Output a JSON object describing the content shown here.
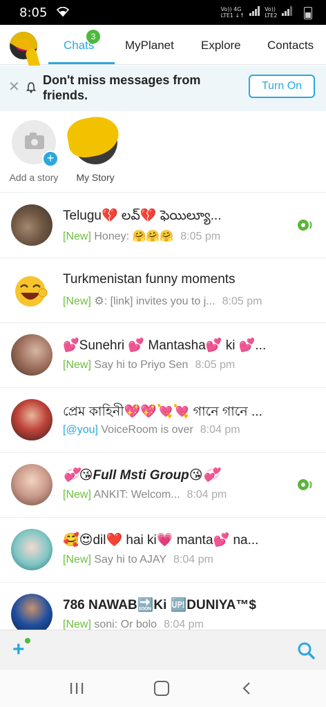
{
  "status_bar": {
    "time": "8:05",
    "network_left": "Vo)) 4G\nLTE1 ↓↑",
    "network_right": "Vo))\nLTE2"
  },
  "tabs": {
    "items": [
      {
        "label": "Chats",
        "active": true,
        "badge": "3"
      },
      {
        "label": "MyPlanet"
      },
      {
        "label": "Explore"
      },
      {
        "label": "Contacts"
      }
    ],
    "accent_color": "#29a8e0",
    "badge_color": "#4cba3c"
  },
  "notice": {
    "message": "Don't miss messages from friends.",
    "close_icon": "close-icon",
    "bell_icon": "bell-icon",
    "button_label": "Turn On"
  },
  "stories": [
    {
      "label": "Add a story",
      "icon": "camera-icon"
    },
    {
      "label": "My Story"
    }
  ],
  "chats": [
    {
      "name": "Telugu💔 లవ్💔 ఫెయిల్యూ...",
      "tag": "[New]",
      "preview": "Honey: 🤗🤗🤗",
      "time": "8:05 pm",
      "voice": true
    },
    {
      "name": "Turkmenistan funny moments",
      "tag": "[New]",
      "preview": "⚙: [link] invites you to j...",
      "time": "8:05 pm",
      "voice": false
    },
    {
      "name": "💕Sunehri 💕 Mantasha💕 ki 💕...",
      "tag": "[New]",
      "preview": "Say hi to Priyo Sen",
      "time": "8:05 pm",
      "voice": false
    },
    {
      "name": "প্রেম কাহিনী💖💖💘💘 গানে গানে ...",
      "tag": "[@you]",
      "preview": "VoiceRoom is over",
      "time": "8:04 pm",
      "voice": false
    },
    {
      "name": "💞😘Full Msti Group😘💞",
      "tag": "[New]",
      "preview": "ANKIT: Welcom...",
      "time": "8:04 pm",
      "voice": true
    },
    {
      "name": "🥰😍dil❤️ hai ki💗 manta💕 na...",
      "tag": "[New]",
      "preview": "Say hi to AJAY",
      "time": "8:04 pm",
      "voice": false
    },
    {
      "name": "786 NAWAB🔜Ki 🆙DUNIYA™$",
      "tag": "[New]",
      "preview": "soni: Or bolo",
      "time": "8:04 pm",
      "voice": false
    }
  ],
  "toolbar": {
    "add_icon": "plus-icon",
    "search_icon": "search-icon"
  },
  "navbar": {
    "recent_icon": "recent-apps-icon",
    "home_icon": "home-icon",
    "back_icon": "back-icon"
  }
}
